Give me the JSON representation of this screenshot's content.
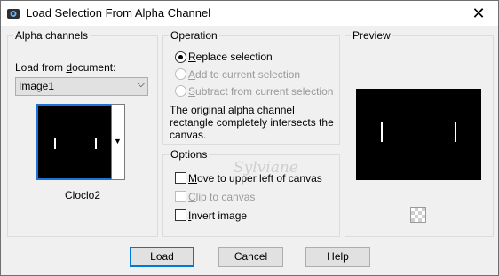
{
  "window": {
    "title": "Load Selection From Alpha Channel"
  },
  "alpha_channels": {
    "group_label": "Alpha channels",
    "load_from_label": "Load from document:",
    "document_value": "Image1",
    "channel_name": "Cloclo2"
  },
  "operation": {
    "group_label": "Operation",
    "options": [
      {
        "label": "Replace selection",
        "selected": true,
        "enabled": true
      },
      {
        "label": "Add to current selection",
        "selected": false,
        "enabled": false
      },
      {
        "label": "Subtract from current selection",
        "selected": false,
        "enabled": false
      }
    ],
    "note": "The original alpha channel rectangle completely intersects the canvas."
  },
  "options": {
    "group_label": "Options",
    "move_label": "Move to upper left of canvas",
    "clip_label": "Clip to canvas",
    "invert_label": "Invert image"
  },
  "preview": {
    "group_label": "Preview"
  },
  "buttons": {
    "load": "Load",
    "cancel": "Cancel",
    "help": "Help"
  },
  "watermark": "Sylviane"
}
